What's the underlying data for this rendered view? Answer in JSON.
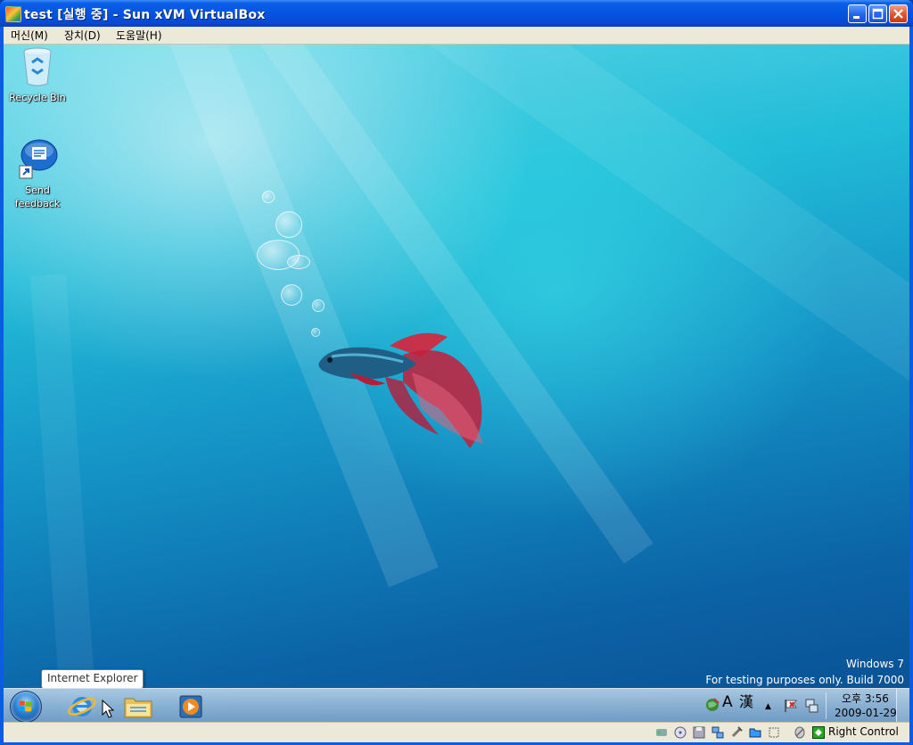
{
  "window": {
    "title": "test [실행 중] - Sun xVM VirtualBox",
    "buttons": [
      "minimize",
      "maximize",
      "close"
    ]
  },
  "menubar": {
    "items": [
      {
        "label": "머신(M)"
      },
      {
        "label": "장치(D)"
      },
      {
        "label": "도움말(H)"
      }
    ]
  },
  "desktop": {
    "icons": [
      {
        "label": "Recycle Bin",
        "icon": "recycle-bin-icon"
      },
      {
        "label": "Send",
        "label2": "feedback",
        "icon": "feedback-icon"
      }
    ],
    "watermark": {
      "line1": "Windows  7",
      "line2": "For testing purposes only. Build 7000"
    },
    "tooltip": "Internet Explorer"
  },
  "taskbar": {
    "pinned": [
      "internet-explorer-icon",
      "windows-explorer-icon",
      "media-player-icon"
    ],
    "ime": {
      "mode": "A",
      "hanja": "漢"
    },
    "tray_arrow": "▲",
    "clock": {
      "time": "오후 3:56",
      "date": "2009-01-29"
    }
  },
  "statusbar": {
    "icons": [
      "hard-disk-icon",
      "cd-icon",
      "floppy-icon",
      "network-icon",
      "usb-icon",
      "shared-folder-icon",
      "display-icon",
      "mouse-integration-icon",
      "host-key-icon"
    ],
    "host_key": "Right Control"
  },
  "colors": {
    "title_blue": "#0554e0",
    "close_red": "#e05a31",
    "menu_bg": "#ece9d8"
  }
}
